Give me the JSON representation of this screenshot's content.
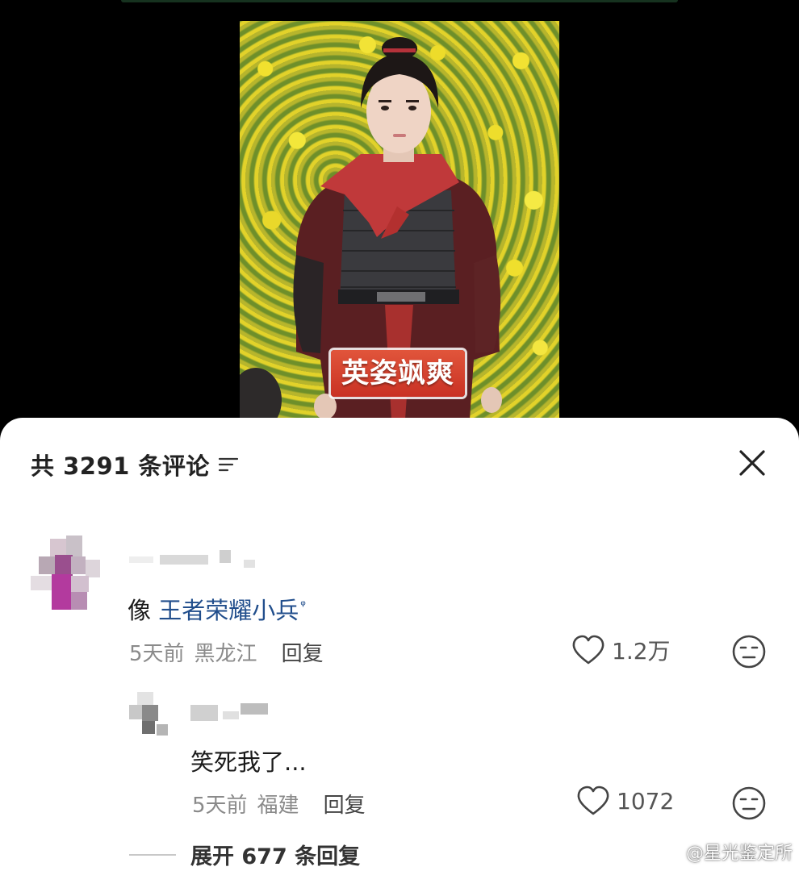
{
  "video": {
    "caption": "英姿飒爽"
  },
  "comments_panel": {
    "count_label": "共 3291 条评论",
    "sort_icon": "filter-lines-icon",
    "close_icon": "close-icon"
  },
  "comment_main": {
    "text_prefix": "像 ",
    "mention": "王者荣耀小兵",
    "mention_icon": "search-icon",
    "time": "5天前",
    "location": "黑龙江",
    "reply_label": "回复",
    "likes": "1.2万",
    "like_icon": "heart-outline-icon",
    "dislike_icon": "expressionless-face-icon"
  },
  "comment_reply": {
    "text": "笑死我了...",
    "time": "5天前",
    "location": "福建",
    "reply_label": "回复",
    "likes": "1072",
    "like_icon": "heart-outline-icon",
    "dislike_icon": "expressionless-face-icon"
  },
  "expand": {
    "label": "展开 677 条回复"
  },
  "watermark": {
    "text": "@星光鉴定所",
    "icon": "weibo-icon"
  }
}
